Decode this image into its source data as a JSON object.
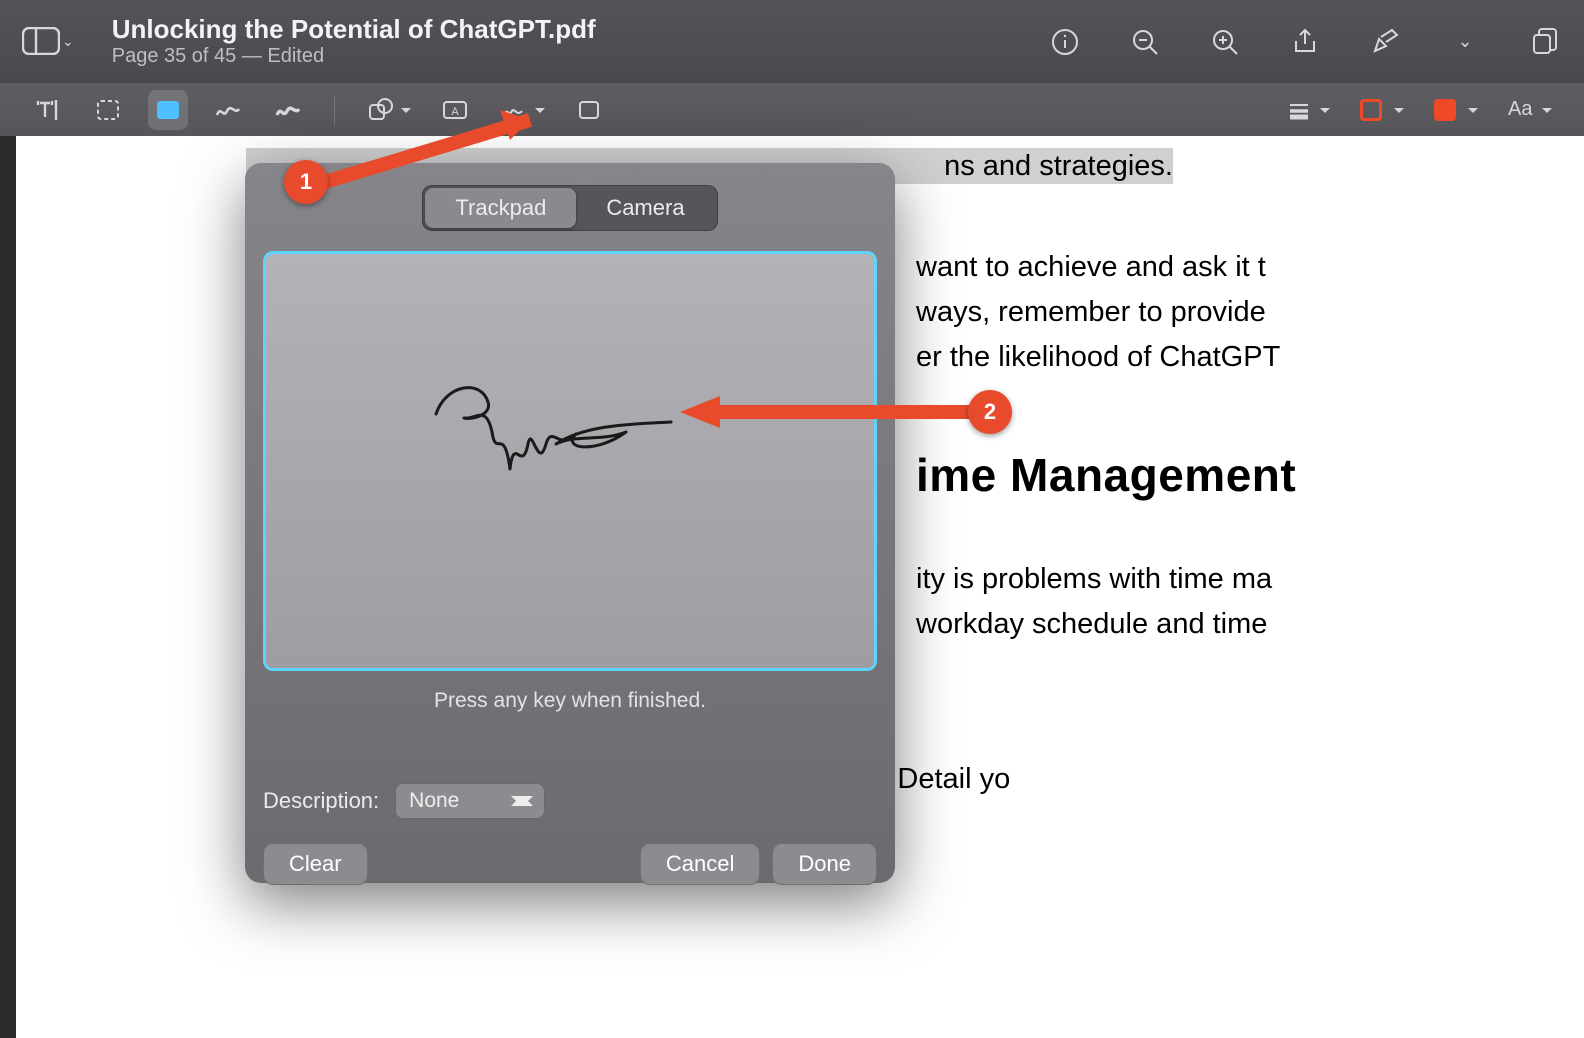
{
  "header": {
    "doc_title": "Unlocking the Potential of ChatGPT.pdf",
    "subtitle": "Page 35 of 45  —  Edited"
  },
  "markup_toolbar": {
    "text_style_label": "Aa"
  },
  "document": {
    "highlight_line": "ns and strategies.",
    "para1_a": "want to achieve and ask it t",
    "para1_b": "ways, remember to provide ",
    "para1_c": "er the likelihood of ChatGPT",
    "heading": "ime Management",
    "para2_a": "ity is problems with time ma",
    "para2_b": "workday schedule and time ",
    "para3": "workday looks like. Detail yo"
  },
  "popover": {
    "tabs": {
      "trackpad": "Trackpad",
      "camera": "Camera",
      "active": "trackpad"
    },
    "hint": "Press any key when finished.",
    "description_label": "Description:",
    "description_value": "None",
    "clear": "Clear",
    "cancel": "Cancel",
    "done": "Done"
  },
  "annotations": {
    "badge1": "1",
    "badge2": "2"
  },
  "colors": {
    "accent": "#e84b2b",
    "swatch": "#ef4a27",
    "canvas_border": "#5fd3fc"
  }
}
